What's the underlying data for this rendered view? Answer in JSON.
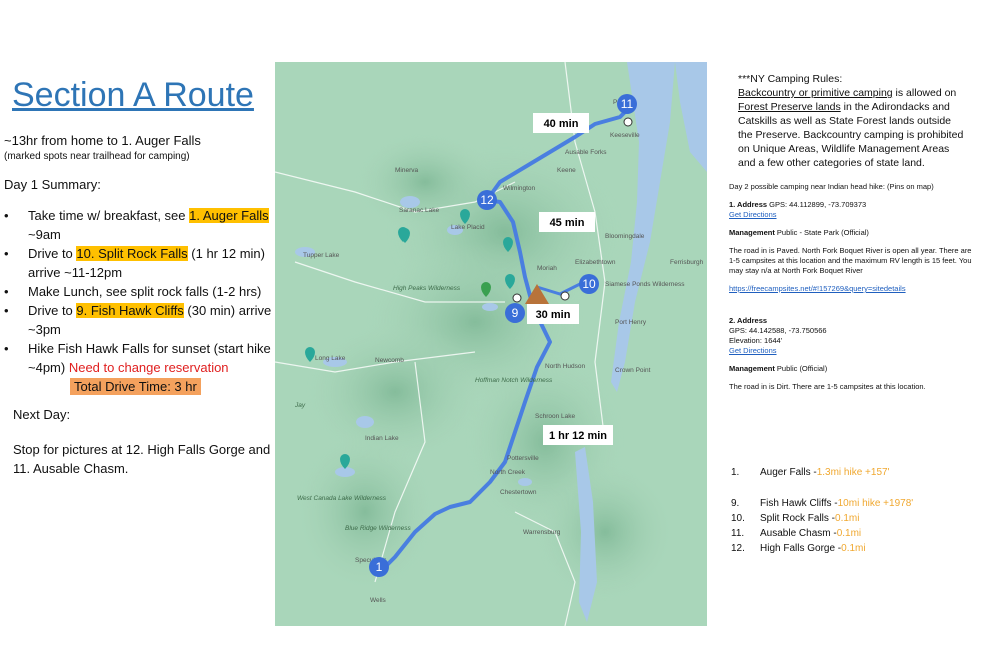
{
  "title": "Section A Route",
  "subtitle": "~13hr from home to 1. Auger Falls",
  "subnote": "(marked spots near trailhead for camping)",
  "summary_heading": "Day 1 Summary:",
  "bullets": [
    {
      "pre": "Take time w/ breakfast, see ",
      "hl": "1. Auger Falls",
      "post": " ~9am",
      "red": ""
    },
    {
      "pre": "Drive to ",
      "hl": "10. Split Rock Falls",
      "post": " (1 hr 12 min) arrive ~11-12pm",
      "red": ""
    },
    {
      "pre": "Make Lunch, see split rock falls (1-2 hrs)",
      "hl": "",
      "post": "",
      "red": ""
    },
    {
      "pre": "Drive to ",
      "hl": "9. Fish Hawk Cliffs",
      "post": " (30 min) arrive ~3pm",
      "red": ""
    },
    {
      "pre": "Hike Fish Hawk Falls for sunset (start hike ~4pm) ",
      "hl": "",
      "post": "",
      "red": "Need to change reservation"
    }
  ],
  "total_drive": "Total Drive Time: 3 hr",
  "next_day": "Next Day:",
  "stop_text": "Stop for pictures at 12. High Falls Gorge and 11. Ausable Chasm.",
  "map": {
    "time_labels": [
      "40 min",
      "45 min",
      "30 min",
      "1 hr 12 min"
    ],
    "pins": [
      "1",
      "9",
      "10",
      "11",
      "12"
    ],
    "places": [
      "Peru",
      "Keeseville",
      "Ausable Forks",
      "Wilmington",
      "Lake Placid",
      "Saranac Lake",
      "Tupper Lake",
      "Long Lake",
      "Newcomb",
      "Indian Lake",
      "Speculator",
      "Wells",
      "North Creek",
      "Pottersville",
      "Chestertown",
      "Warrensburg",
      "Schroon Lake",
      "North Hudson",
      "Elizabethtown",
      "Port Henry",
      "Crown Point",
      "Ferrisburgh",
      "High Peaks Wilderness",
      "Hoffman Notch Wilderness",
      "West Canada Lake Wilderness",
      "Siamese Ponds Wilderness",
      "Blue Ridge Wilderness",
      "Jay",
      "Keene",
      "Moriah",
      "Bloomingdale",
      "Minerva"
    ],
    "colors": {
      "route": "#4a7fe0",
      "pin": "#3a6ed8",
      "camp": "#b8733a",
      "water": "#a8c8e8",
      "land": "#a8d4b8"
    }
  },
  "rules": {
    "header": "***NY Camping Rules:",
    "link1": "Backcountry or primitive camping",
    "text1": " is allowed on ",
    "link2": "Forest Preserve lands",
    "text2": " in the Adirondacks and Catskills as well as State Forest lands outside the Preserve. Backcountry camping is prohibited on Unique Areas, Wildlife Management Areas and a few other categories of state land."
  },
  "day2": {
    "heading": "Day 2 possible camping near Indian head hike: (Pins on map)",
    "a1_label": "1. Address",
    "a1_gps": " GPS: 44.112899, -73.709373",
    "get_directions": "Get Directions",
    "mgmt_label": "Management",
    "mgmt1": " Public - State Park (Official)",
    "road1": "The road in is Paved. North Fork Boquet River is open all year. There are 1-5 campsites at this location and the maximum RV length is 15 feet. You may stay n/a at North Fork Boquet River",
    "url": "https://freecampsites.net/#!157269&query=sitedetails",
    "a2_label": "2. Address",
    "a2_gps": "GPS: 44.142588, -73.750566",
    "a2_elev": "Elevation: 1644'",
    "mgmt2": " Public (Official)",
    "road2": "The road in is Dirt. There are 1-5 campsites at this location."
  },
  "hikes": [
    {
      "num": "1.",
      "name": "Auger Falls - ",
      "detail": "1.3mi hike +157'"
    },
    {
      "num": "9.",
      "name": "Fish Hawk Cliffs - ",
      "detail": "10mi hike +1978'"
    },
    {
      "num": "10.",
      "name": "Split Rock Falls - ",
      "detail": "0.1mi"
    },
    {
      "num": "11.",
      "name": "Ausable Chasm - ",
      "detail": "0.1mi"
    },
    {
      "num": "12.",
      "name": "High Falls Gorge - ",
      "detail": "0.1mi"
    }
  ]
}
